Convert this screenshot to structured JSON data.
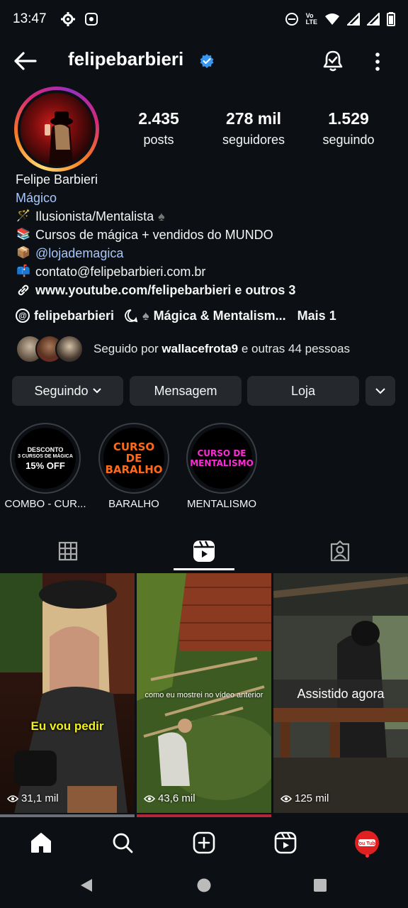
{
  "status_bar": {
    "time": "13:47",
    "network_label": "Vo’\nLTE"
  },
  "header": {
    "username": "felipebarbieri"
  },
  "profile": {
    "stats": [
      {
        "value": "2.435",
        "label": "posts"
      },
      {
        "value": "278 mil",
        "label": "seguidores"
      },
      {
        "value": "1.529",
        "label": "seguindo"
      }
    ],
    "name": "Felipe Barbieri",
    "category": "Mágico",
    "bio": [
      {
        "emoji": "🪄",
        "text": "Ilusionista/Mentalista",
        "suffix": "♠"
      },
      {
        "emoji": "📚",
        "text": "Cursos de mágica + vendidos do MUNDO"
      },
      {
        "emoji": "📦",
        "text": "@lojademagica"
      },
      {
        "emoji": "📫",
        "text": "contato@felipebarbieri.com.br"
      }
    ],
    "link": "www.youtube.com/felipebarbieri e outros 3",
    "threads_handle": "felipebarbieri",
    "channel": "Mágica & Mentalism...",
    "more": "Mais 1",
    "followed_by_prefix": "Seguido por ",
    "followed_by_user": "wallacefrota9",
    "followed_by_suffix": " e outras 44 pessoas"
  },
  "buttons": {
    "following": "Seguindo",
    "message": "Mensagem",
    "shop": "Loja"
  },
  "highlights": [
    {
      "label": "COMBO - CUR...",
      "cover_lines": [
        "DESCONTO",
        "3 CURSOS DE MÁGICA",
        "15% OFF"
      ]
    },
    {
      "label": "BARALHO",
      "cover_lines": [
        "CURSO DE",
        "BARALHO"
      ]
    },
    {
      "label": "MENTALISMO",
      "cover_lines": [
        "CURSO DE",
        "MENTALISMO"
      ]
    }
  ],
  "reels": [
    {
      "views": "31,1 mil",
      "caption": "Eu vou pedir"
    },
    {
      "views": "43,6 mil",
      "caption": "como eu mostrei no vídeo anterior"
    },
    {
      "views": "125 mil",
      "caption": "Assistido agora"
    }
  ],
  "colors": {
    "background": "#0c1014",
    "link": "#a8c7fa",
    "button": "#25292e",
    "verified": "#3897f0"
  }
}
